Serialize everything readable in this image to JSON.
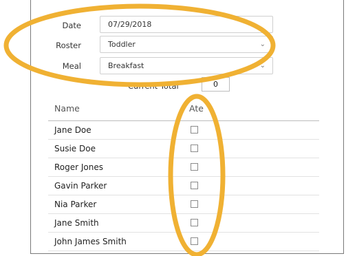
{
  "form": {
    "date": {
      "label": "Date",
      "value": "07/29/2018"
    },
    "roster": {
      "label": "Roster",
      "value": "Toddler"
    },
    "meal": {
      "label": "Meal",
      "value": "Breakfast"
    },
    "current_total": {
      "label": "Current Total",
      "value": "0"
    }
  },
  "table": {
    "headers": {
      "name": "Name",
      "ate": "Ate"
    },
    "rows": [
      {
        "name": "Jane Doe",
        "ate": false
      },
      {
        "name": "Susie Doe",
        "ate": false
      },
      {
        "name": "Roger Jones",
        "ate": false
      },
      {
        "name": "Gavin Parker",
        "ate": false
      },
      {
        "name": "Nia Parker",
        "ate": false
      },
      {
        "name": "Jane Smith",
        "ate": false
      },
      {
        "name": "John James Smith",
        "ate": false
      }
    ]
  },
  "annotation": {
    "color": "#f0b133"
  },
  "icons": {
    "dropdown": "chevron-down-icon",
    "checkbox": "checkbox-icon"
  }
}
